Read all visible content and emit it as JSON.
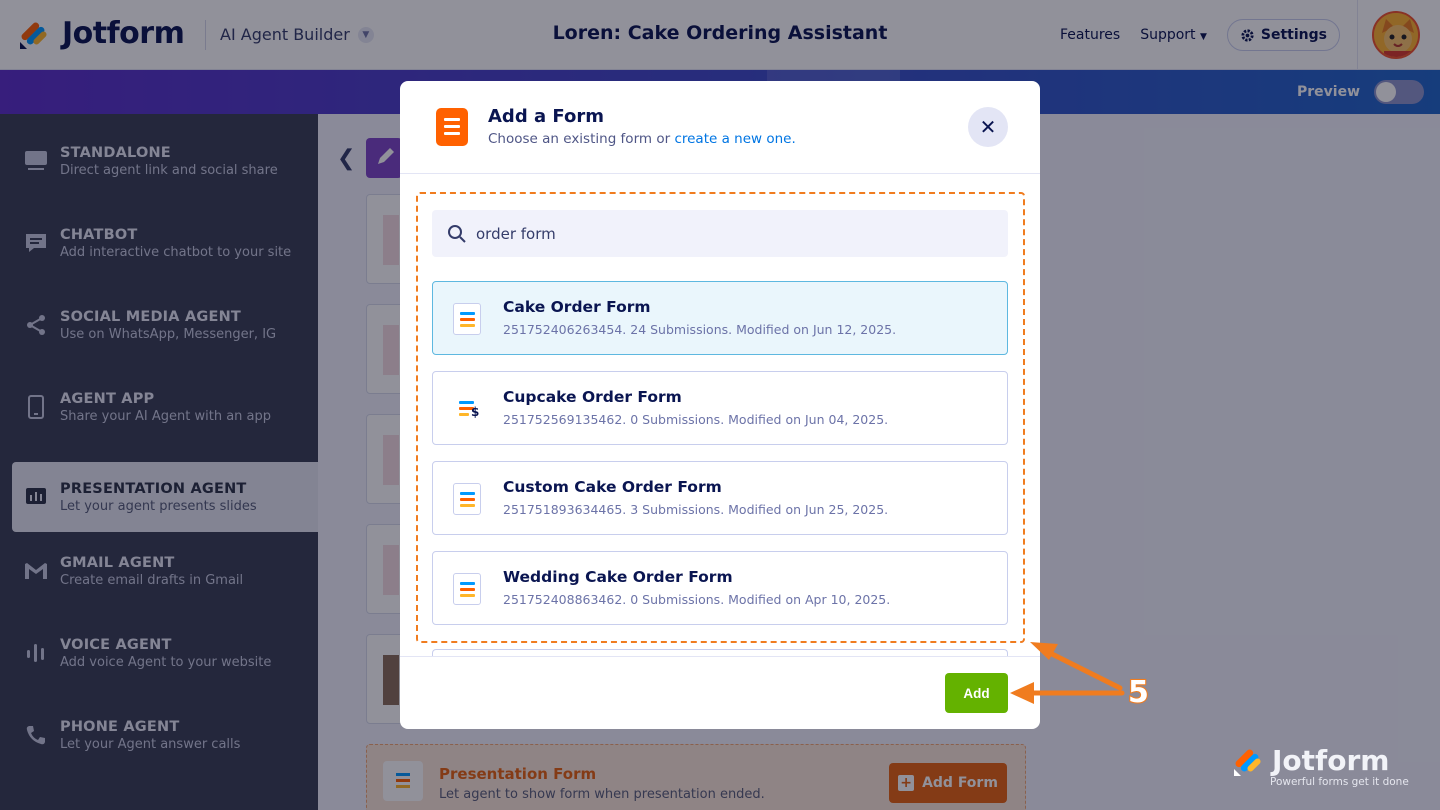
{
  "header": {
    "logo_text": "Jotform",
    "builder_label": "AI Agent Builder",
    "app_title": "Loren: Cake Ordering Assistant",
    "nav": {
      "features": "Features",
      "support": "Support",
      "settings": "Settings"
    }
  },
  "preview": {
    "label": "Preview",
    "enabled": false
  },
  "sidebar": {
    "items": [
      {
        "title": "STANDALONE",
        "sub": "Direct agent link and social share",
        "icon": "monitor-icon"
      },
      {
        "title": "CHATBOT",
        "sub": "Add interactive chatbot to your site",
        "icon": "chat-icon"
      },
      {
        "title": "SOCIAL MEDIA AGENT",
        "sub": "Use on WhatsApp, Messenger, IG",
        "icon": "share-icon"
      },
      {
        "title": "AGENT APP",
        "sub": "Share your AI Agent with an app",
        "icon": "phone-icon"
      },
      {
        "title": "PRESENTATION AGENT",
        "sub": "Let your agent presents slides",
        "icon": "presentation-icon",
        "active": true
      },
      {
        "title": "GMAIL AGENT",
        "sub": "Create email drafts in Gmail",
        "icon": "gmail-icon"
      },
      {
        "title": "VOICE AGENT",
        "sub": "Add voice Agent to your website",
        "icon": "voice-icon"
      },
      {
        "title": "PHONE AGENT",
        "sub": "Let your Agent answer calls",
        "icon": "phone-call-icon"
      }
    ]
  },
  "presentation_form": {
    "title": "Presentation Form",
    "sub": "Let agent to show form when presentation ended.",
    "button": "Add Form"
  },
  "modal": {
    "title": "Add a Form",
    "sub_prefix": "Choose an existing form or ",
    "sub_link": "create a new one.",
    "search_value": "order form",
    "forms": [
      {
        "title": "Cake Order Form",
        "meta": "251752406263454. 24 Submissions. Modified on Jun 12, 2025.",
        "selected": true
      },
      {
        "title": "Cupcake Order Form",
        "meta": "251752569135462. 0 Submissions. Modified on Jun 04, 2025.",
        "selected": false
      },
      {
        "title": "Custom Cake Order Form",
        "meta": "251751893634465. 3 Submissions. Modified on Jun 25, 2025.",
        "selected": false
      },
      {
        "title": "Wedding Cake Order Form",
        "meta": "251752408863462. 0 Submissions. Modified on Apr 10, 2025.",
        "selected": false
      }
    ],
    "add_button": "Add"
  },
  "annotation": {
    "step": "5"
  },
  "watermark": {
    "text": "Jotform",
    "tagline": "Powerful forms get it done"
  },
  "colors": {
    "accent_orange": "#f07c1f",
    "add_green": "#64b200",
    "brand_navy": "#0a1551",
    "link_blue": "#0075e3"
  }
}
